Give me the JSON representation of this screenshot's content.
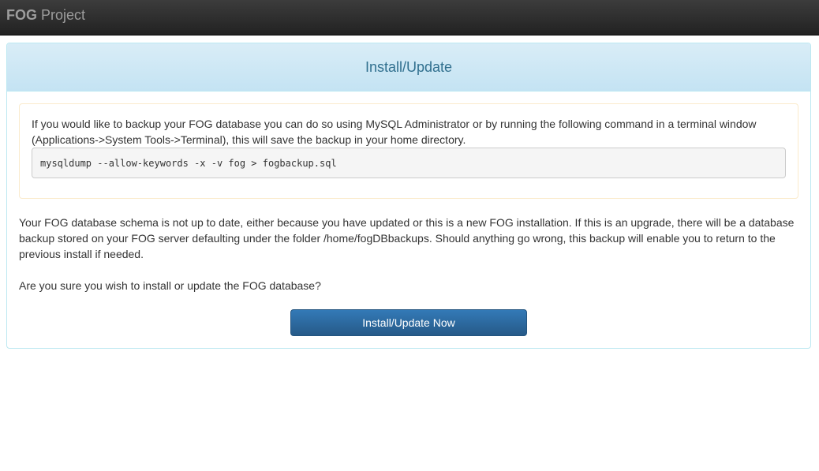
{
  "navbar": {
    "brand_bold": "FOG",
    "brand_rest": " Project"
  },
  "panel": {
    "title": "Install/Update",
    "backup_notice": "If you would like to backup your FOG database you can do so using MySQL Administrator or by running the following command in a terminal window (Applications->System Tools->Terminal), this will save the backup in your home directory.",
    "backup_command": "mysqldump --allow-keywords -x -v fog > fogbackup.sql",
    "schema_message": "Your FOG database schema is not up to date, either because you have updated or this is a new FOG installation. If this is an upgrade, there will be a database backup stored on your FOG server defaulting under the folder /home/fogDBbackups. Should anything go wrong, this backup will enable you to return to the previous install if needed.",
    "confirm_question": "Are you sure you wish to install or update the FOG database?",
    "submit_label": "Install/Update Now"
  },
  "colors": {
    "navbar_bg": "#222222",
    "heading_bg": "#d9edf7",
    "heading_text": "#31708f",
    "warning_border": "#faebcc",
    "button_bg": "#337ab7"
  }
}
